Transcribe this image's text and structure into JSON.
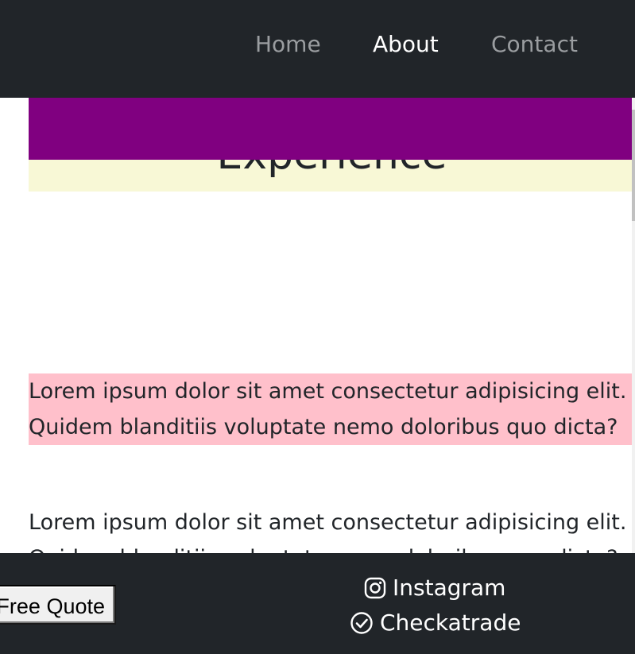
{
  "nav": {
    "items": [
      {
        "label": "Home"
      },
      {
        "label": "About"
      },
      {
        "label": "Contact"
      }
    ]
  },
  "hero": {
    "title": "Experience"
  },
  "content": {
    "paragraphs": [
      {
        "line1": "Lorem ipsum dolor sit amet consectetur adipisicing elit.",
        "line2": "Quidem blanditiis voluptate nemo doloribus quo dicta?"
      },
      {
        "line1": "Lorem ipsum dolor sit amet consectetur adipisicing elit.",
        "line2": "Quidem blanditiis voluptate nemo doloribus quo dicta?"
      }
    ]
  },
  "footer": {
    "quote_button": "Free Quote",
    "social": [
      {
        "label": "Instagram",
        "icon": "instagram-icon"
      },
      {
        "label": "Checkatrade",
        "icon": "check-circle-icon"
      }
    ]
  },
  "colors": {
    "navbar": "#212529",
    "hero_band": "#800080",
    "hero_bg": "#f8f8d6",
    "highlight": "#ffc0cb"
  }
}
